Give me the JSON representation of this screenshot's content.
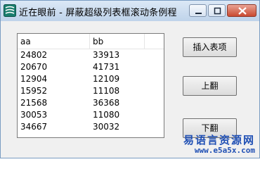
{
  "window": {
    "title": "近在眼前 - 屏蔽超级列表框滚动条例程",
    "icon": "app-logo-icon",
    "controls": [
      "minimize-icon",
      "maximize-icon",
      "close-icon"
    ]
  },
  "list": {
    "columns": [
      "aa",
      "bb"
    ],
    "rows": [
      [
        "24802",
        "33913"
      ],
      [
        "20670",
        "41731"
      ],
      [
        "12904",
        "12109"
      ],
      [
        "15952",
        "11108"
      ],
      [
        "21568",
        "36368"
      ],
      [
        "30053",
        "11080"
      ],
      [
        "34667",
        "30032"
      ]
    ]
  },
  "buttons": {
    "insert": "插入表项",
    "up": "上翻",
    "down": "下翻"
  },
  "watermark": {
    "chinese": "易语言资源网",
    "url": "www.e5a5x.com"
  },
  "colors": {
    "titlebar": "#c8daef",
    "watermark": "#1f4fb4"
  }
}
